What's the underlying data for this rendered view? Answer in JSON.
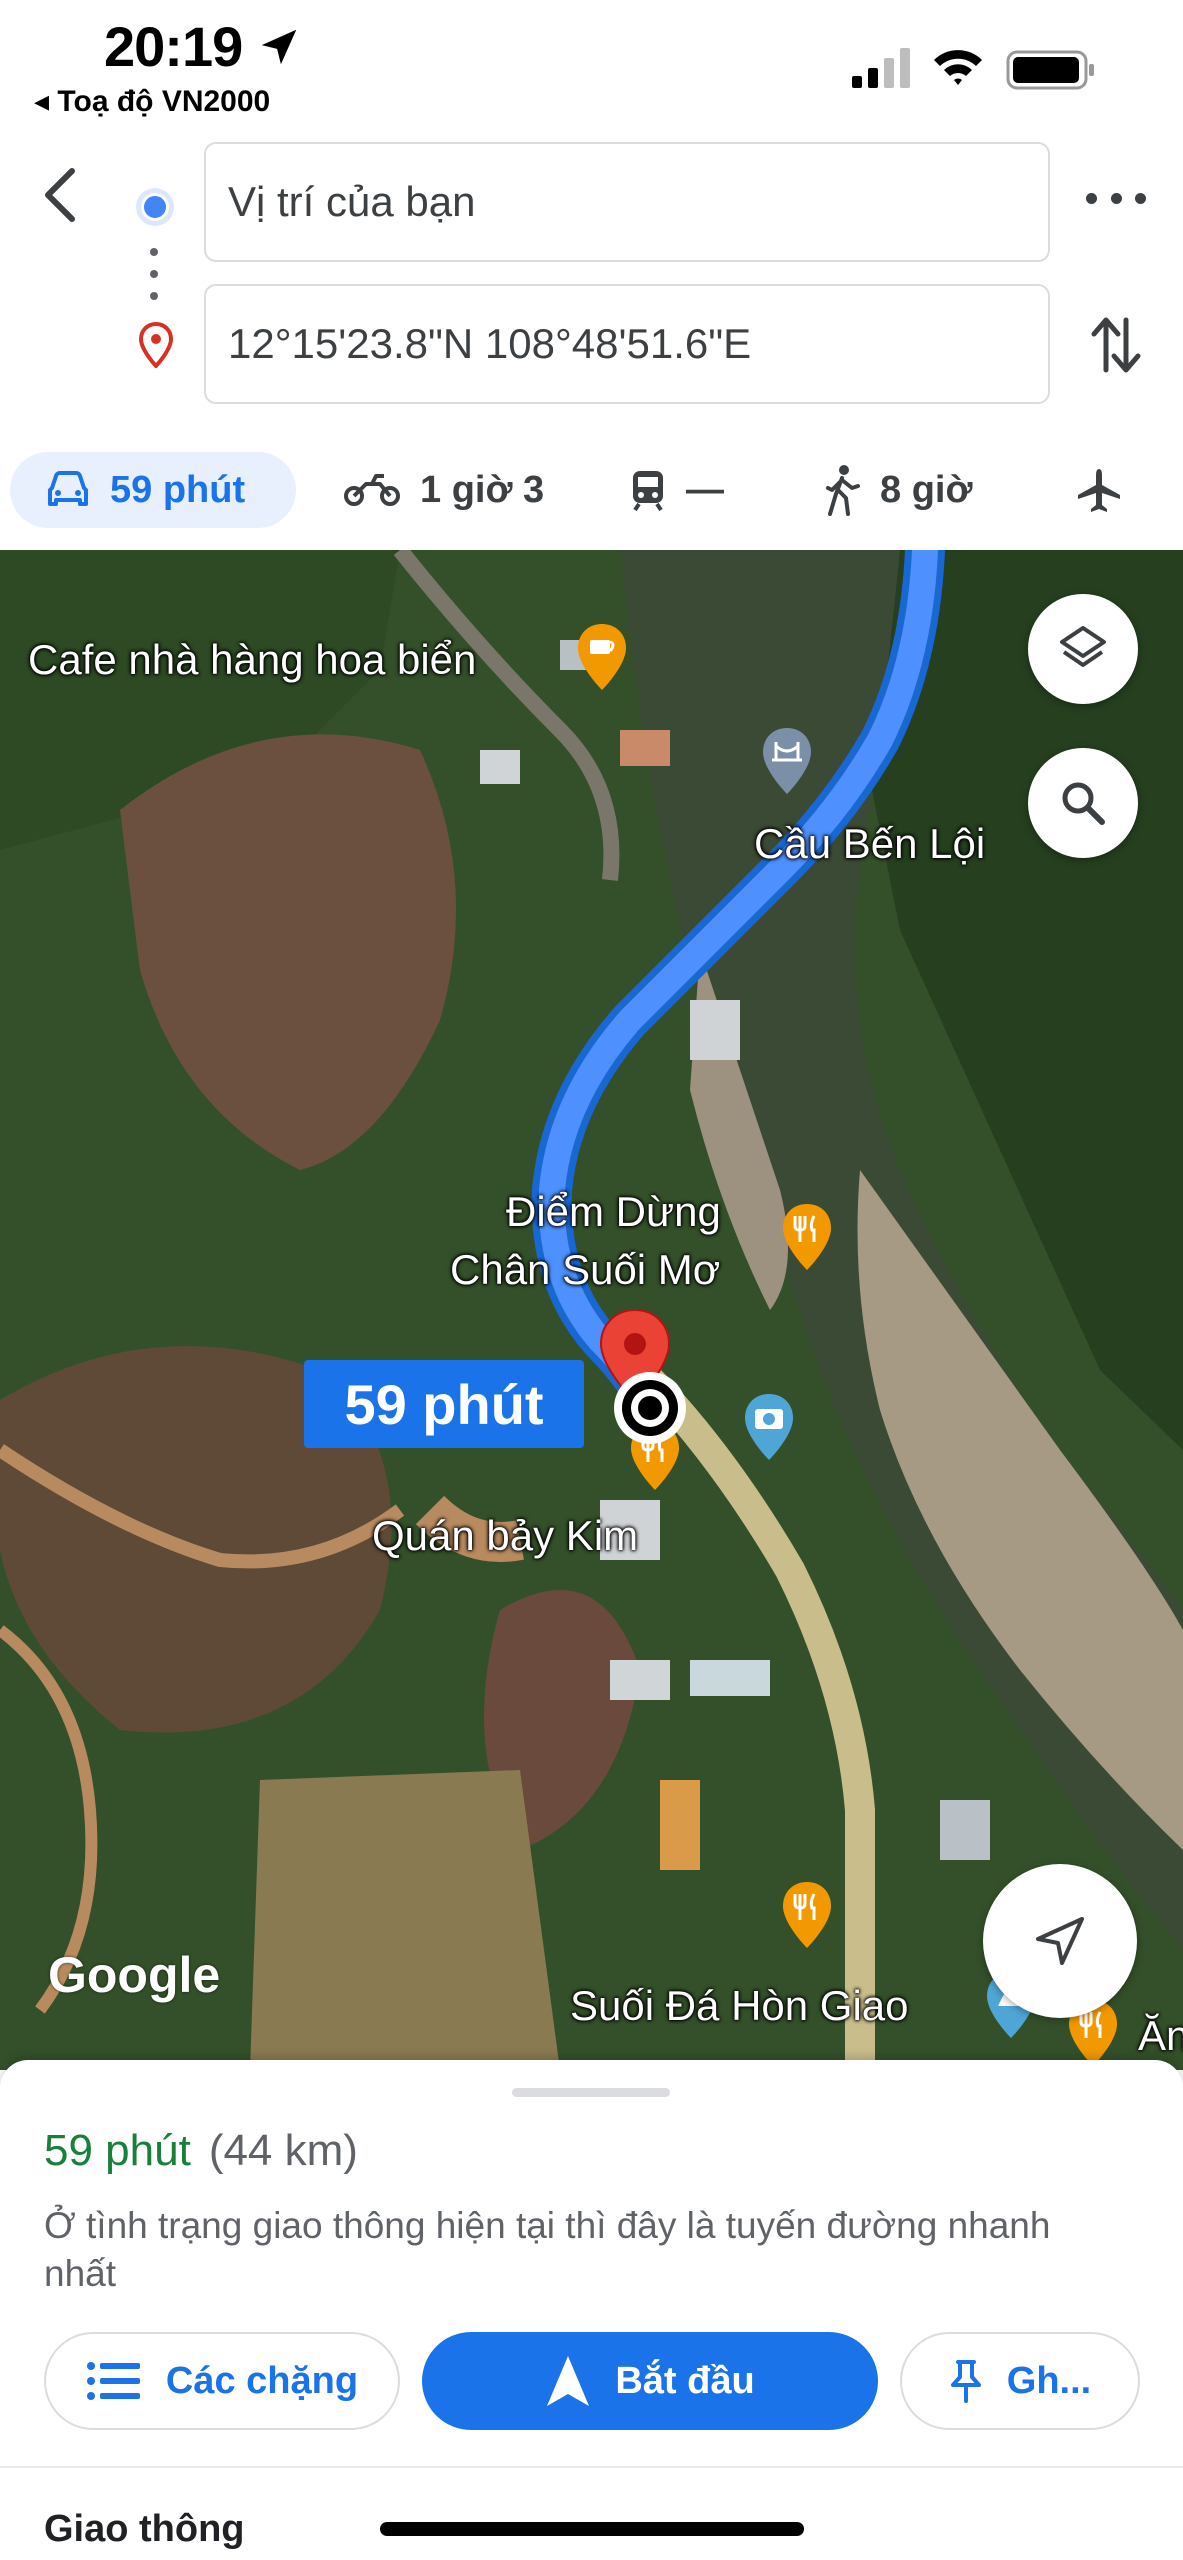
{
  "status_bar": {
    "time": "20:19",
    "back_app": "◂ Toạ độ VN2000"
  },
  "directions": {
    "origin": "Vị trí của bạn",
    "destination": "12°15'23.8\"N 108°48'51.6\"E"
  },
  "modes": [
    {
      "name": "drive",
      "label": "59 phút",
      "selected": true
    },
    {
      "name": "motorbike",
      "label": "1 giờ 3"
    },
    {
      "name": "transit",
      "label": "—"
    },
    {
      "name": "walk",
      "label": "8 giờ"
    },
    {
      "name": "flight",
      "label": ""
    }
  ],
  "map": {
    "labels": {
      "cafe": "Cafe nhà hàng hoa biển",
      "bridge": "Cầu Bến Lội",
      "stop_line1": "Điểm Dừng",
      "stop_line2": "Chân Suối Mơ",
      "quan_bay": "Quán bảy Kim",
      "suoi_da": "Suối Đá Hòn Giao",
      "cut_off": "Ăn"
    },
    "eta_box": "59 phút",
    "logo": "Google",
    "colors": {
      "route": "#4285f4",
      "pin": "#ea4335",
      "poi_food": "#f29900",
      "poi_blue": "#4fa6d6"
    }
  },
  "sheet": {
    "duration": "59 phút",
    "distance": "(44 km)",
    "note": "Ở tình trạng giao thông hiện tại thì đây là tuyến đường nhanh nhất",
    "buttons": {
      "steps": "Các chặng",
      "start": "Bắt đầu",
      "pin": "Gh..."
    },
    "traffic_title": "Giao thông"
  }
}
